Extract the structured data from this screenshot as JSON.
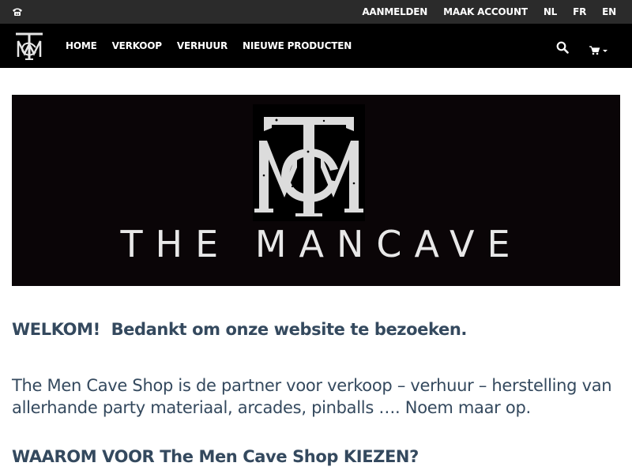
{
  "topbar": {
    "phone_icon": "phone-icon",
    "links": {
      "login": "AANMELDEN",
      "create_account": "MAAK ACCOUNT",
      "lang_nl": "NL",
      "lang_fr": "FR",
      "lang_en": "EN"
    },
    "bg_color": "#2b2b2b"
  },
  "navbar": {
    "logo_icon": "mancave-monogram-logo",
    "items": [
      "HOME",
      "VERKOOP",
      "VERHUUR",
      "NIEUWE PRODUCTEN"
    ],
    "search_icon": "search-icon",
    "cart_icon": "cart-icon",
    "bg_color": "#000000"
  },
  "banner": {
    "brand_text": "THE MANCAVE"
  },
  "content": {
    "welcome": "WELKOM!  Bedankt om onze website te bezoeken.",
    "intro": "The Men Cave Shop is de partner voor verkoop – verhuur – herstelling van allerhande party materiaal, arcades, pinballs …. Noem maar op.",
    "why_heading": "WAAROM VOOR The Men Cave Shop KIEZEN?",
    "text_color": "#34495e"
  }
}
